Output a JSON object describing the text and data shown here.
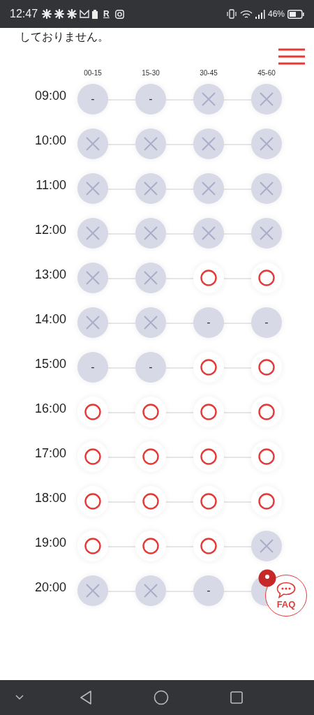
{
  "status_bar": {
    "time": "12:47",
    "app_letter": "R",
    "battery": "46%"
  },
  "notice": "しておりません。",
  "columns": [
    "00-15",
    "15-30",
    "30-45",
    "45-60"
  ],
  "rows": [
    {
      "time": "09:00",
      "cells": [
        {
          "kind": "dash",
          "text": "-"
        },
        {
          "kind": "dash",
          "text": "-"
        },
        {
          "kind": "full"
        },
        {
          "kind": "full"
        }
      ]
    },
    {
      "time": "10:00",
      "cells": [
        {
          "kind": "full"
        },
        {
          "kind": "full"
        },
        {
          "kind": "full"
        },
        {
          "kind": "full"
        }
      ]
    },
    {
      "time": "11:00",
      "cells": [
        {
          "kind": "full"
        },
        {
          "kind": "full"
        },
        {
          "kind": "full"
        },
        {
          "kind": "full"
        }
      ]
    },
    {
      "time": "12:00",
      "cells": [
        {
          "kind": "full"
        },
        {
          "kind": "full"
        },
        {
          "kind": "full"
        },
        {
          "kind": "full"
        }
      ]
    },
    {
      "time": "13:00",
      "cells": [
        {
          "kind": "full"
        },
        {
          "kind": "full"
        },
        {
          "kind": "open"
        },
        {
          "kind": "open"
        }
      ]
    },
    {
      "time": "14:00",
      "cells": [
        {
          "kind": "full"
        },
        {
          "kind": "full"
        },
        {
          "kind": "dash",
          "text": "-"
        },
        {
          "kind": "dash",
          "text": "-"
        }
      ]
    },
    {
      "time": "15:00",
      "cells": [
        {
          "kind": "dash",
          "text": "-"
        },
        {
          "kind": "dash",
          "text": "-"
        },
        {
          "kind": "open"
        },
        {
          "kind": "open"
        }
      ]
    },
    {
      "time": "16:00",
      "cells": [
        {
          "kind": "open"
        },
        {
          "kind": "open"
        },
        {
          "kind": "open"
        },
        {
          "kind": "open"
        }
      ]
    },
    {
      "time": "17:00",
      "cells": [
        {
          "kind": "open"
        },
        {
          "kind": "open"
        },
        {
          "kind": "open"
        },
        {
          "kind": "open"
        }
      ]
    },
    {
      "time": "18:00",
      "cells": [
        {
          "kind": "open"
        },
        {
          "kind": "open"
        },
        {
          "kind": "open"
        },
        {
          "kind": "open"
        }
      ]
    },
    {
      "time": "19:00",
      "cells": [
        {
          "kind": "open"
        },
        {
          "kind": "open"
        },
        {
          "kind": "open"
        },
        {
          "kind": "full"
        }
      ]
    },
    {
      "time": "20:00",
      "cells": [
        {
          "kind": "full"
        },
        {
          "kind": "full"
        },
        {
          "kind": "dash",
          "text": "-"
        },
        {
          "kind": "covered"
        }
      ]
    }
  ],
  "faq_button": {
    "label": "FAQ"
  }
}
